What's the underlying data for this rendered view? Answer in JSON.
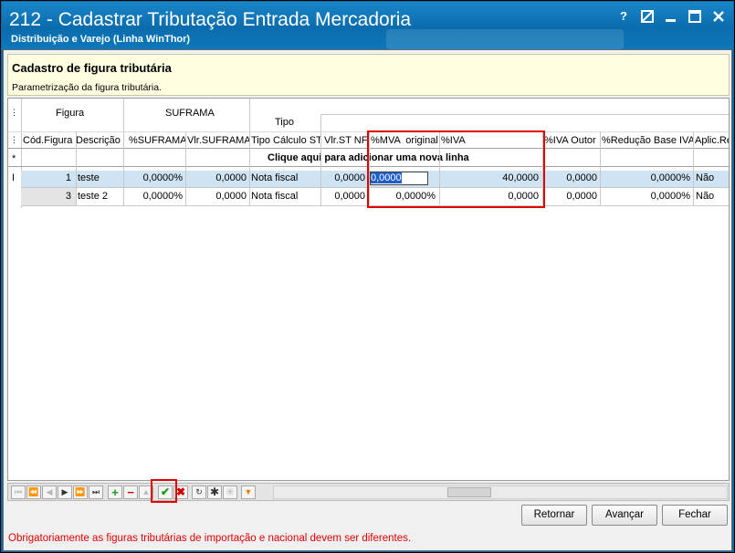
{
  "window": {
    "title": "212 - Cadastrar Tributação Entrada Mercadoria",
    "subtitle": "Distribuição e Varejo (Linha WinThor)",
    "help_label": "?",
    "accent": "#0b6cad"
  },
  "panel": {
    "title": "Cadastro de figura tributária",
    "subtitle": "Parametrização da figura tributária."
  },
  "grid": {
    "band_figura": "Figura",
    "band_suframa": "SUFRAMA",
    "band_tipo": "Tipo",
    "columns": [
      "Cód.Figura",
      "Descrição",
      "%SUFRAMA",
      "Vlr.SUFRAMA",
      "Tipo Cálculo ST",
      "Vlr.ST NF",
      "%MVA  original",
      "%IVA",
      "%IVA Outor",
      "%Redução Base IVA",
      "Aplic.Re"
    ],
    "new_row_text": "Clique aqui para adicionar uma nova linha",
    "row_indicator_new": "*",
    "row_indicator_edit": "I",
    "rows": [
      [
        "1",
        "teste",
        "0,0000%",
        "0,0000",
        "Nota fiscal",
        "0,0000",
        "0,0000",
        "40,0000",
        "0,0000",
        "0,0000%",
        "Não"
      ],
      [
        "3",
        "teste 2",
        "0,0000%",
        "0,0000",
        "Nota fiscal",
        "0,0000",
        "0,0000%",
        "0,0000",
        "0,0000",
        "0,0000%",
        "Não"
      ]
    ]
  },
  "buttons": {
    "retornar": "Retornar",
    "avancar": "Avançar",
    "fechar": "Fechar"
  },
  "warning": "Obrigatoriamente as figuras tributárias de importação e nacional devem ser diferentes.",
  "colors": {
    "highlight": "#e00000",
    "selection": "#cfe3f3"
  }
}
